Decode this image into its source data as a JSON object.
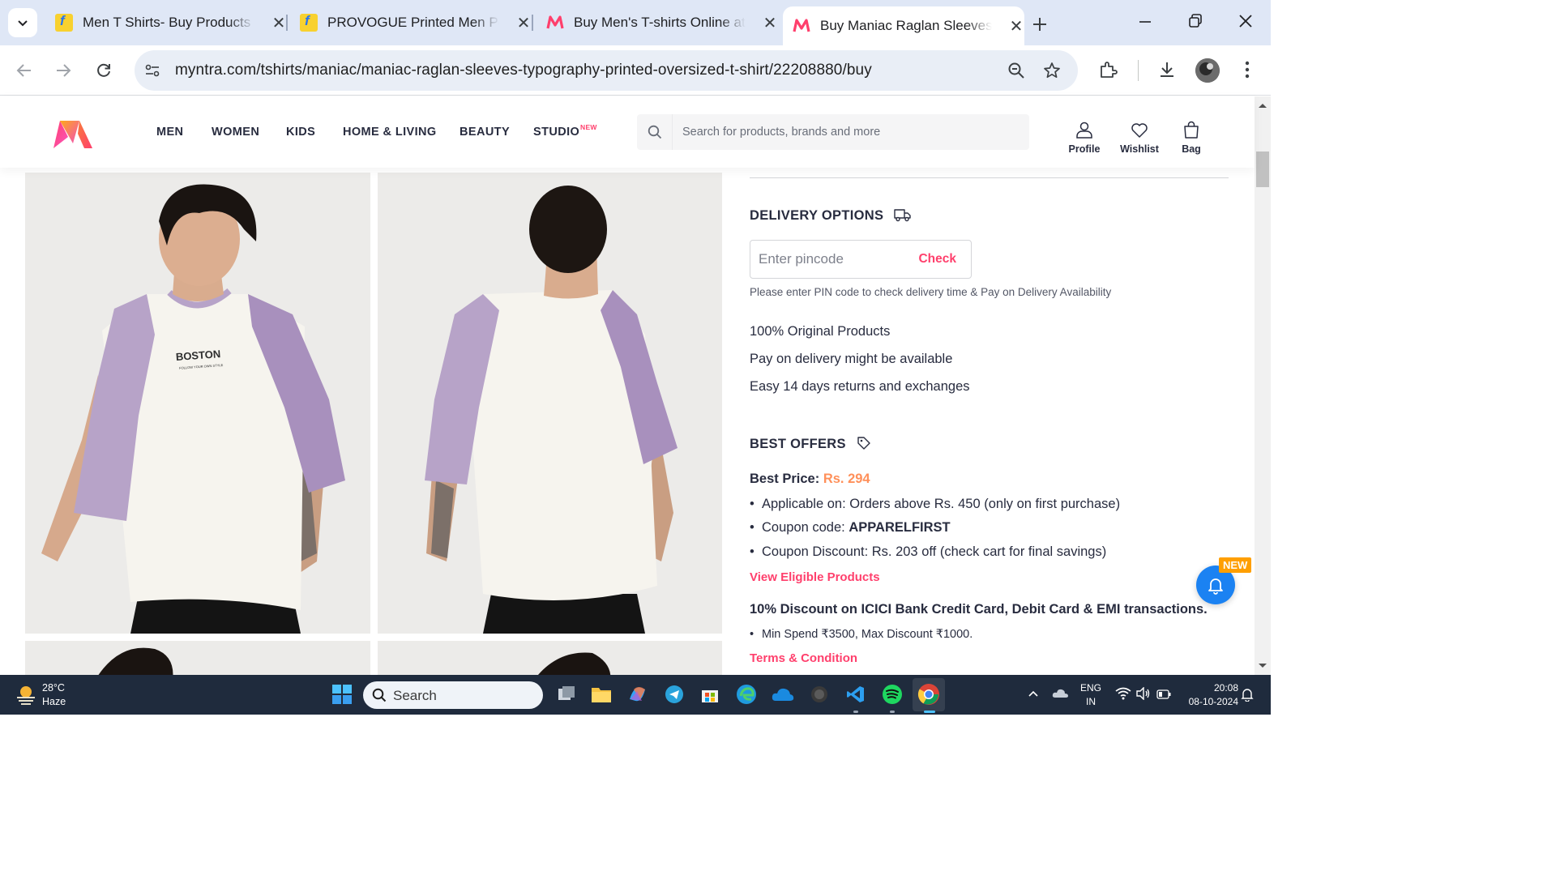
{
  "browser": {
    "tabs": [
      {
        "title": "Men T Shirts- Buy Products Online",
        "favicon": "flipkart-icon",
        "active": false
      },
      {
        "title": "PROVOGUE Printed Men Polo Neck",
        "favicon": "flipkart-icon",
        "active": false
      },
      {
        "title": "Buy Men's T-shirts Online at Best",
        "favicon": "myntra-icon",
        "active": false
      },
      {
        "title": "Buy Maniac Raglan Sleeves Typography",
        "favicon": "myntra-icon",
        "active": true
      }
    ],
    "url": "myntra.com/tshirts/maniac/maniac-raglan-sleeves-typography-printed-oversized-t-shirt/22208880/buy"
  },
  "site": {
    "nav": [
      "MEN",
      "WOMEN",
      "KIDS",
      "HOME & LIVING",
      "BEAUTY",
      "STUDIO"
    ],
    "nav_badge": "NEW",
    "search_placeholder": "Search for products, brands and more",
    "actions": {
      "profile": "Profile",
      "wishlist": "Wishlist",
      "bag": "Bag"
    },
    "accent": "#ff3f6c"
  },
  "product": {
    "print_text": "BOSTON",
    "print_subtext": "FOLLOW YOUR OWN STYLE"
  },
  "delivery": {
    "title": "DELIVERY OPTIONS",
    "pincode_placeholder": "Enter pincode",
    "check_label": "Check",
    "help": "Please enter PIN code to check delivery time & Pay on Delivery Availability",
    "assurances": [
      "100% Original Products",
      "Pay on delivery might be available",
      "Easy 14 days returns and exchanges"
    ]
  },
  "offers": {
    "title": "BEST OFFERS",
    "best_price_label": "Best Price:",
    "best_price_value": "Rs. 294",
    "items": [
      {
        "text": "Applicable on: Orders above Rs. 450 (only on first purchase)",
        "bold": ""
      },
      {
        "text": "Coupon code: ",
        "bold": "APPARELFIRST"
      },
      {
        "text": "Coupon Discount: Rs. 203 off (check cart for final savings)",
        "bold": ""
      }
    ],
    "view_eligible": "View Eligible Products",
    "bank_title": "10% Discount on ICICI Bank Credit Card, Debit Card & EMI transactions.",
    "bank_item": "Min Spend ₹3500, Max Discount ₹1000.",
    "terms": "Terms & Condition",
    "notify_badge": "NEW"
  },
  "taskbar": {
    "weather_temp": "28°C",
    "weather_desc": "Haze",
    "search_label": "Search",
    "lang_1": "ENG",
    "lang_2": "IN",
    "time": "20:08",
    "date": "08-10-2024"
  }
}
